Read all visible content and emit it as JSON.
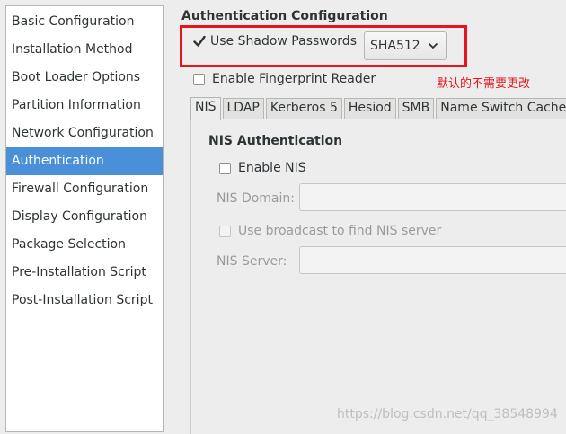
{
  "sidebar": {
    "items": [
      {
        "label": "Basic Configuration"
      },
      {
        "label": "Installation Method"
      },
      {
        "label": "Boot Loader Options"
      },
      {
        "label": "Partition Information"
      },
      {
        "label": "Network Configuration"
      },
      {
        "label": "Authentication"
      },
      {
        "label": "Firewall Configuration"
      },
      {
        "label": "Display Configuration"
      },
      {
        "label": "Package Selection"
      },
      {
        "label": "Pre-Installation Script"
      },
      {
        "label": "Post-Installation Script"
      }
    ],
    "selected": "Authentication"
  },
  "main": {
    "title": "Authentication Configuration",
    "shadow_passwords": {
      "label": "Use Shadow Passwords",
      "checked": true
    },
    "hash_dropdown": {
      "value": "SHA512"
    },
    "fingerprint": {
      "label": "Enable Fingerprint Reader",
      "checked": false
    },
    "annotation": "默认的不需要更改",
    "tabs": [
      {
        "label": "NIS"
      },
      {
        "label": "LDAP"
      },
      {
        "label": "Kerberos 5"
      },
      {
        "label": "Hesiod"
      },
      {
        "label": "SMB"
      },
      {
        "label": "Name Switch Cache"
      }
    ],
    "active_tab": "NIS",
    "nis": {
      "title": "NIS Authentication",
      "enable_label": "Enable NIS",
      "domain_label": "NIS Domain:",
      "domain_value": "",
      "broadcast_label": "Use broadcast to find NIS server",
      "server_label": "NIS Server:",
      "server_value": ""
    }
  },
  "watermark": "https://blog.csdn.net/qq_38548994",
  "colors": {
    "accent": "#4a90d9",
    "annotation": "#e8141c"
  }
}
